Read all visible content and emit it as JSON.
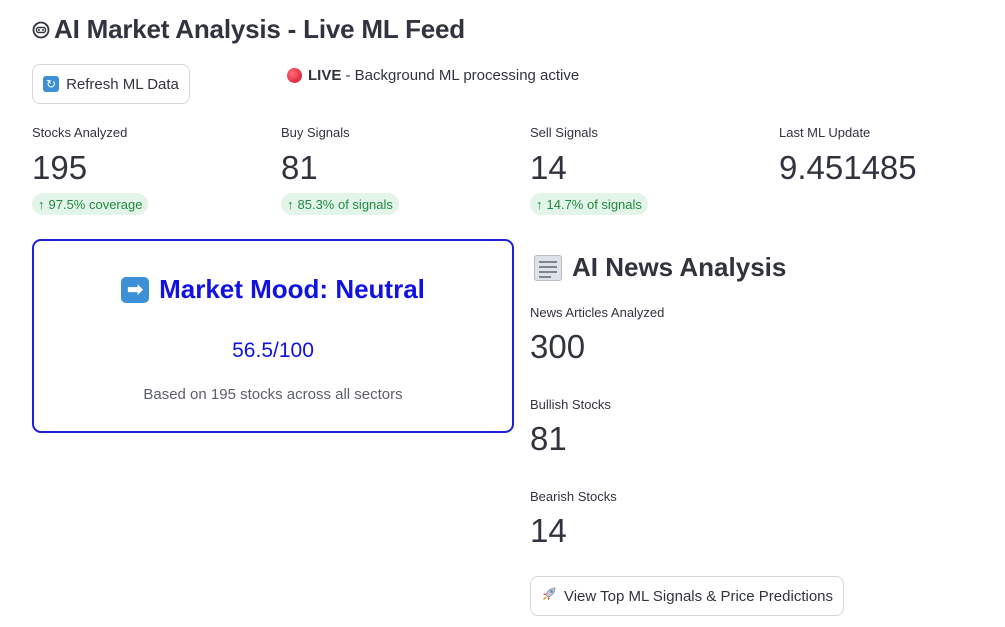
{
  "page": {
    "title": "AI Market Analysis - Live ML Feed",
    "title_icon": "robot-icon"
  },
  "toolbar": {
    "refresh_label": "Refresh ML Data",
    "refresh_icon": "refresh-icon"
  },
  "status": {
    "live_label": "LIVE",
    "live_text": " - Background ML processing active",
    "live_color": "#e0162f"
  },
  "metrics": [
    {
      "label": "Stocks Analyzed",
      "value": "195",
      "delta": "97.5% coverage"
    },
    {
      "label": "Buy Signals",
      "value": "81",
      "delta": "85.3% of signals"
    },
    {
      "label": "Sell Signals",
      "value": "14",
      "delta": "14.7% of signals"
    },
    {
      "label": "Last ML Update",
      "value": "9.451485",
      "delta": ""
    }
  ],
  "mood": {
    "icon": "arrow-right-icon",
    "title": "Market Mood: Neutral",
    "score": "56.5/100",
    "note": "Based on 195 stocks across all sectors",
    "accent_color": "#1212e0"
  },
  "news": {
    "icon": "newspaper-icon",
    "title": "AI News Analysis",
    "metrics": [
      {
        "label": "News Articles Analyzed",
        "value": "300"
      },
      {
        "label": "Bullish Stocks",
        "value": "81"
      },
      {
        "label": "Bearish Stocks",
        "value": "14"
      }
    ],
    "button_label": "View Top ML Signals & Price Predictions",
    "button_icon": "rocket-icon"
  },
  "colors": {
    "delta_bg": "#e3f4e9",
    "delta_text": "#1f8a3d",
    "text": "#31333f"
  }
}
